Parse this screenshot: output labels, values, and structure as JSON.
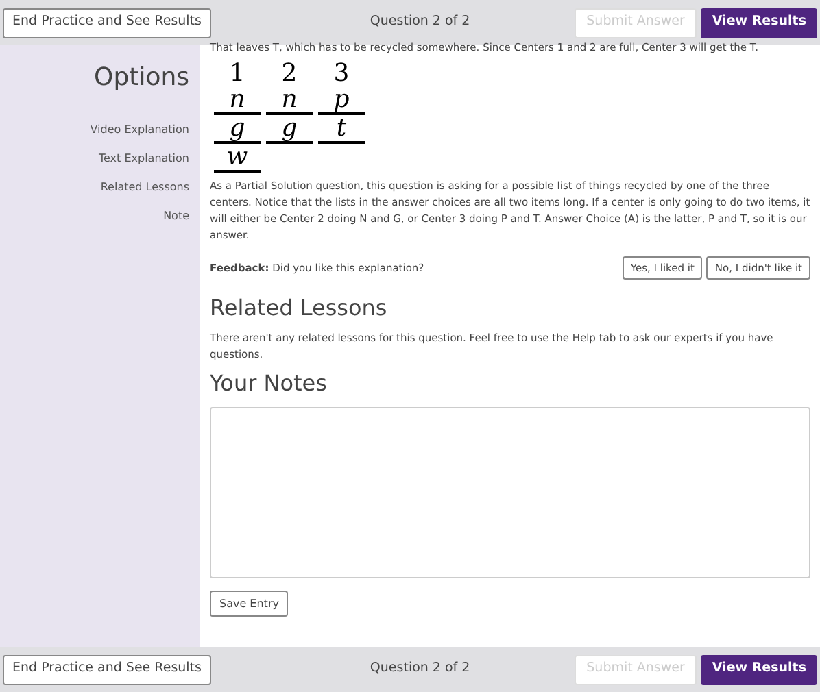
{
  "top_bar": {
    "end_button": "End Practice and See Results",
    "counter": "Question 2 of 2",
    "buttons": [
      {
        "label": "Submit Answer",
        "disabled": true
      },
      {
        "label": "View Results",
        "disabled": false
      }
    ]
  },
  "sidebar": {
    "title": "Options",
    "items": [
      "Video Explanation",
      "Text Explanation",
      "Related Lessons",
      "Note"
    ]
  },
  "explanation": {
    "intro": "That leaves T, which has to be recycled somewhere. Since Centers 1 and 2 are full, Center 3 will get the T.",
    "sketch": [
      {
        "header": "1",
        "entries": [
          "n",
          "g",
          "w"
        ]
      },
      {
        "header": "2",
        "entries": [
          "n",
          "g"
        ]
      },
      {
        "header": "3",
        "entries": [
          "p",
          "t"
        ]
      }
    ],
    "body": "As a Partial Solution question, this question is asking for a possible list of things recycled by one of the three centers. Notice that the lists in the answer choices are all two items long. If a center is only going to do two items, it will either be Center 2 doing N and G, or Center 3 doing P and T. Answer Choice (A) is the latter, P and T, so it is our answer.",
    "feedback": "**Feedback:** Did you like this explanation?",
    "feedback_buttons": [
      "Yes, I liked it",
      "No, I didn't like it"
    ]
  },
  "related": {
    "title": "Related Lessons",
    "text": "There aren't any related lessons for this question. Feel free to use the Help tab to ask our experts if you have questions."
  },
  "notes": {
    "title": "Your Notes",
    "save_button": "Save Entry"
  },
  "bottom_bar": {
    "end_button": "End Practice and See Results",
    "counter": "Question 2 of 2",
    "buttons": [
      {
        "label": "Submit Answer",
        "disabled": true
      },
      {
        "label": "View Results",
        "disabled": false
      }
    ]
  }
}
